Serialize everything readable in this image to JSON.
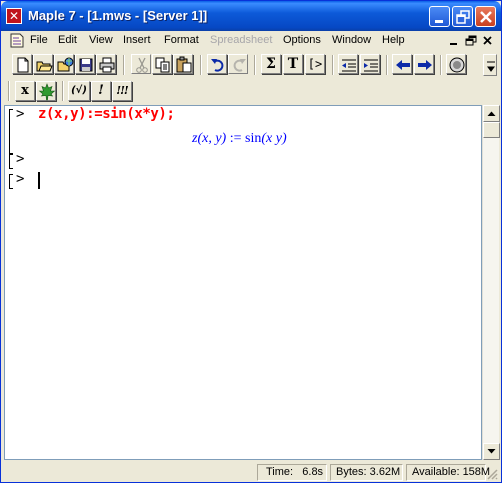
{
  "window": {
    "title": "Maple 7 - [1.mws - [Server 1]]",
    "app_icon_glyph": "✕"
  },
  "menu": {
    "items": [
      {
        "label": "File",
        "name": "menu-file",
        "disabled": false
      },
      {
        "label": "Edit",
        "name": "menu-edit",
        "disabled": false
      },
      {
        "label": "View",
        "name": "menu-view",
        "disabled": false
      },
      {
        "label": "Insert",
        "name": "menu-insert",
        "disabled": false
      },
      {
        "label": "Format",
        "name": "menu-format",
        "disabled": false
      },
      {
        "label": "Spreadsheet",
        "name": "menu-spreadsheet",
        "disabled": true
      },
      {
        "label": "Options",
        "name": "menu-options",
        "disabled": false
      },
      {
        "label": "Window",
        "name": "menu-window",
        "disabled": false
      },
      {
        "label": "Help",
        "name": "menu-help",
        "disabled": false
      }
    ]
  },
  "toolbar": {
    "sum_glyph": "Σ",
    "text_glyph": "T",
    "prompt_glyph": "[>"
  },
  "context_toolbar": {
    "x_label": "x",
    "eval_label": "(√)",
    "exec_label": "!",
    "exec_all_label": "!!!"
  },
  "worksheet": {
    "prompt": ">",
    "input_command": "z(x,y):=sin(x*y);",
    "output": {
      "lhs_fn": "z",
      "lhs_args": "(x, y)",
      "assign": " := ",
      "rhs_fn": "sin",
      "rhs_args": "(x y)"
    }
  },
  "status": {
    "time_label": "Time:",
    "time_value": "6.8s",
    "bytes_label": "Bytes:",
    "bytes_value": "3.62M",
    "available_label": "Available:",
    "available_value": "158M"
  },
  "colors": {
    "input": "#ff0000",
    "output": "#0000ff",
    "titlebar": "#0a5fe6"
  }
}
